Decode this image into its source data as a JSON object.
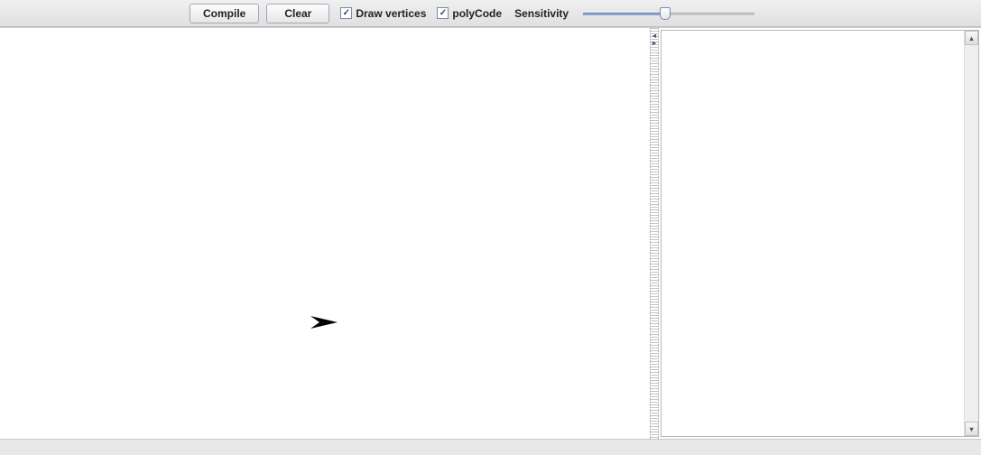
{
  "toolbar": {
    "compile_label": "Compile",
    "clear_label": "Clear",
    "draw_vertices_label": "Draw vertices",
    "draw_vertices_checked": true,
    "polycode_label": "polyCode",
    "polycode_checked": true,
    "sensitivity_label": "Sensitivity",
    "sensitivity_value": 48,
    "sensitivity_min": 0,
    "sensitivity_max": 100
  },
  "canvas": {
    "arrow_icon_name": "pointer-arrow"
  },
  "side_panel": {
    "text_content": ""
  },
  "status": {
    "text": ""
  }
}
